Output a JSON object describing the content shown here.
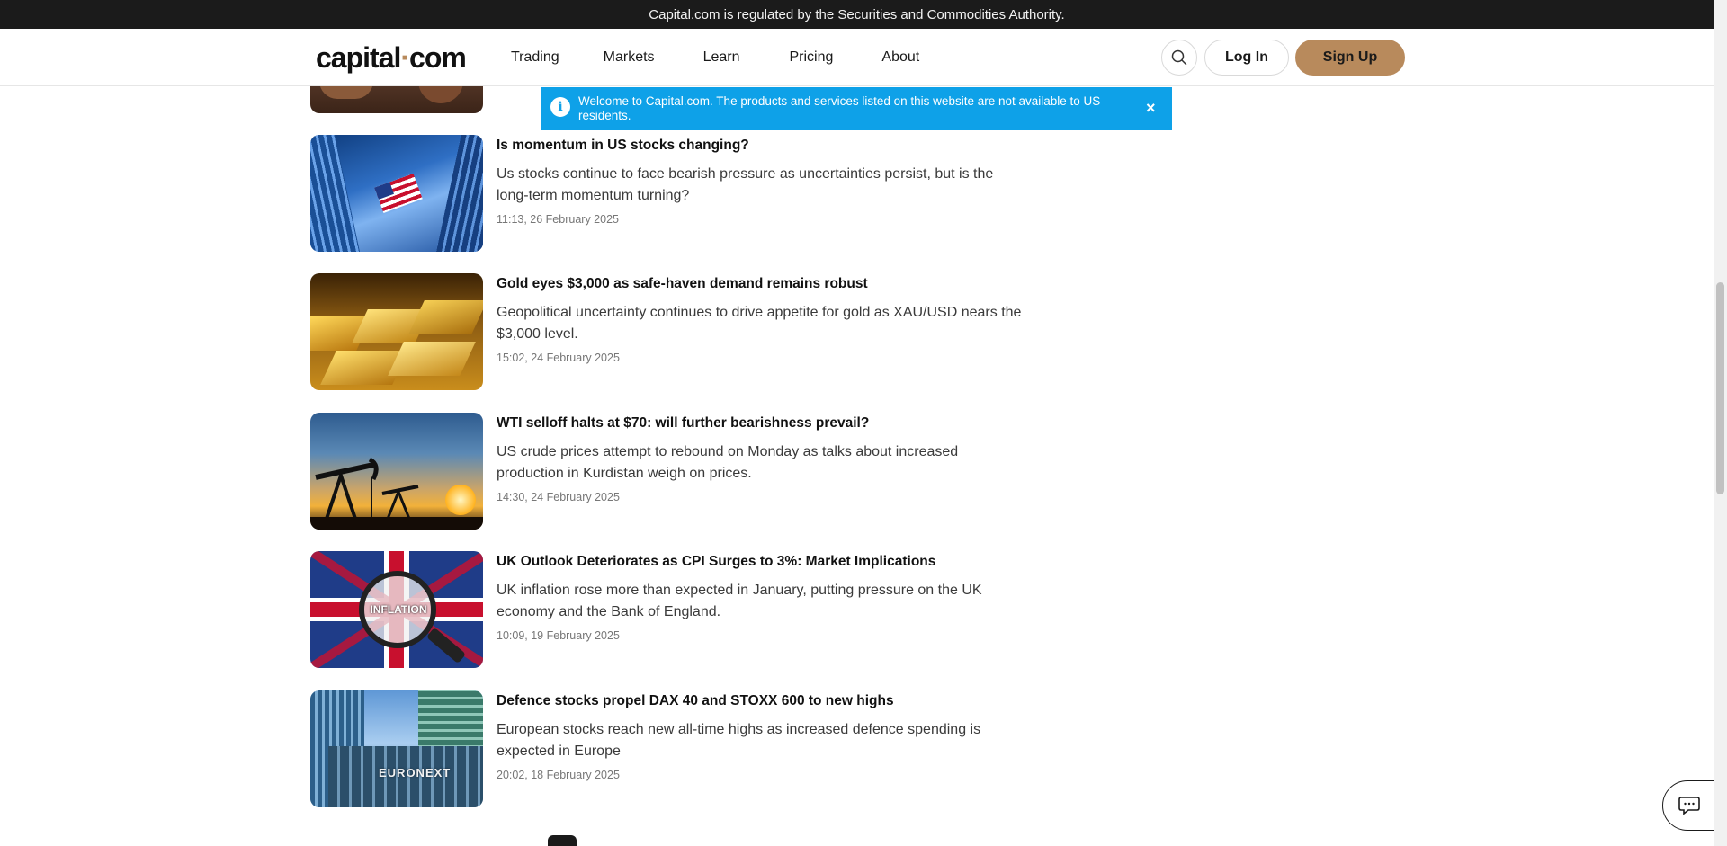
{
  "topbar": {
    "text": "Capital.com is regulated by the Securities and Commodities Authority."
  },
  "header": {
    "logo_left": "capital",
    "logo_dot": "·",
    "logo_right": "com",
    "nav": [
      "Trading",
      "Markets",
      "Learn",
      "Pricing",
      "About"
    ],
    "search_icon": "search-icon",
    "login_label": "Log In",
    "signup_label": "Sign Up",
    "accent_color": "#b88a5c"
  },
  "banner": {
    "message": "Welcome to Capital.com. The products and services listed on this website are not available to US residents.",
    "icon": "info-icon",
    "close": "×",
    "color": "#0ea1e8"
  },
  "articles": [
    {
      "title": "Is momentum in US stocks changing?",
      "description": "Us stocks continue to face bearish pressure as uncertainties persist, but is the long-term momentum turning?",
      "time": "11:13, 26 February 2025",
      "image": "skyscrapers-us-flag"
    },
    {
      "title": "Gold eyes $3,000 as safe-haven demand remains robust",
      "description": "Geopolitical uncertainty continues to drive appetite for gold as XAU/USD nears the $3,000 level.",
      "time": "15:02, 24 February 2025",
      "image": "gold-bars"
    },
    {
      "title": "WTI selloff halts at $70: will further bearishness prevail?",
      "description": "US crude prices attempt to rebound on Monday as talks about increased production in Kurdistan weigh on prices.",
      "time": "14:30, 24 February 2025",
      "image": "oil-pumpjack-sunset"
    },
    {
      "title": "UK Outlook Deteriorates as CPI Surges to 3%: Market Implications",
      "description": "UK inflation rose more than expected in January, putting pressure on the UK economy and the Bank of England.",
      "time": "10:09, 19 February 2025",
      "image": "uk-flag-inflation-magnifier",
      "image_text": "INFLATION"
    },
    {
      "title": "Defence stocks propel DAX 40 and STOXX 600 to new highs",
      "description": "European stocks reach new all-time highs as increased defence spending is expected in Europe",
      "time": "20:02, 18 February 2025",
      "image": "euronext-building",
      "image_text": "EURONEXT"
    }
  ],
  "chat": {
    "icon": "chat-icon"
  }
}
